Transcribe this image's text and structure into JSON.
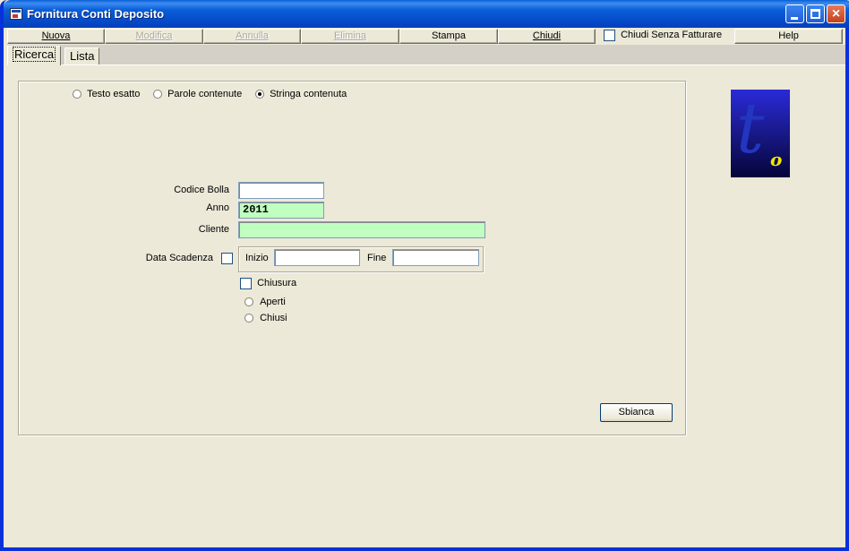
{
  "window": {
    "title": "Fornitura Conti Deposito"
  },
  "toolbar": {
    "nuova": "Nuova",
    "modifica": "Modifica",
    "annulla": "Annulla",
    "elimina": "Elimina",
    "stampa": "Stampa",
    "chiudi": "Chiudi",
    "chiudi_senza_fatturare": "Chiudi Senza Fatturare",
    "help": "Help"
  },
  "tabs": [
    "Ricerca",
    "Lista"
  ],
  "search_mode": {
    "options": [
      "Testo esatto",
      "Parole contenute",
      "Stringa contenuta"
    ],
    "selected": "Stringa contenuta"
  },
  "form": {
    "codice_bolla_label": "Codice Bolla",
    "codice_bolla_value": "",
    "anno_label": "Anno",
    "anno_value": "2011",
    "cliente_label": "Cliente",
    "cliente_value": "",
    "data_scadenza_label": "Data Scadenza",
    "inizio_label": "Inizio",
    "inizio_value": "",
    "fine_label": "Fine",
    "fine_value": "",
    "chiusura_label": "Chiusura",
    "aperti_label": "Aperti",
    "chiusi_label": "Chiusi",
    "sbianca_button": "Sbianca"
  },
  "colors": {
    "title_bar": "#0a5fd8",
    "required_field": "#c1ffc1",
    "window_bg": "#ece9d8"
  },
  "logo": {
    "icon": "to-logo"
  }
}
